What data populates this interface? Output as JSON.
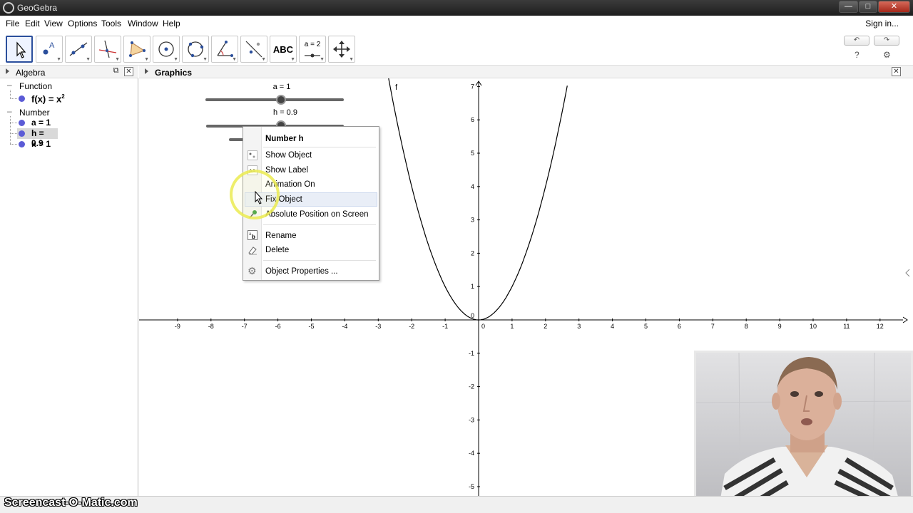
{
  "window": {
    "title": "GeoGebra"
  },
  "menubar": {
    "items": [
      "File",
      "Edit",
      "View",
      "Options",
      "Tools",
      "Window",
      "Help"
    ],
    "signin": "Sign in..."
  },
  "toolbar": {
    "text_tool_label": "ABC",
    "slider_tool_label": "a = 2",
    "help_label": "?"
  },
  "algebra": {
    "title": "Algebra",
    "categories": [
      "Function",
      "Number"
    ],
    "function_item": {
      "name": "f(x) = x",
      "exponent": "2"
    },
    "number_items": [
      "a = 1",
      "h = 0.9",
      "k = 1"
    ]
  },
  "graphics": {
    "title": "Graphics",
    "sliders": [
      {
        "label": "a = 1",
        "value": 1
      },
      {
        "label": "h = 0.9",
        "value": 0.9
      }
    ],
    "curve_label": "f"
  },
  "chart_data": {
    "type": "line",
    "function": "f(x) = x^2",
    "x_ticks": [
      -9,
      -8,
      -7,
      -6,
      -5,
      -4,
      -3,
      -2,
      -1,
      0,
      1,
      2,
      3,
      4,
      5,
      6,
      7,
      8,
      9,
      10,
      11,
      12
    ],
    "y_ticks": [
      -5,
      -4,
      -3,
      -2,
      -1,
      0,
      1,
      2,
      3,
      4,
      5,
      6,
      7
    ],
    "series": [
      {
        "name": "f",
        "x": [
          -2.7,
          -2.5,
          -2,
          -1.5,
          -1,
          -0.5,
          0,
          0.5,
          1,
          1.5,
          2,
          2.5,
          2.65
        ],
        "y": [
          7.29,
          6.25,
          4,
          2.25,
          1,
          0.25,
          0,
          0.25,
          1,
          2.25,
          4,
          6.25,
          7.02
        ]
      }
    ]
  },
  "context_menu": {
    "header": "Number h",
    "items": [
      "Show Object",
      "Show Label",
      "Animation On",
      "Fix Object",
      "Absolute Position on Screen",
      "Rename",
      "Delete",
      "Object Properties ..."
    ]
  },
  "watermark": "Screencast-O-Matic.com"
}
